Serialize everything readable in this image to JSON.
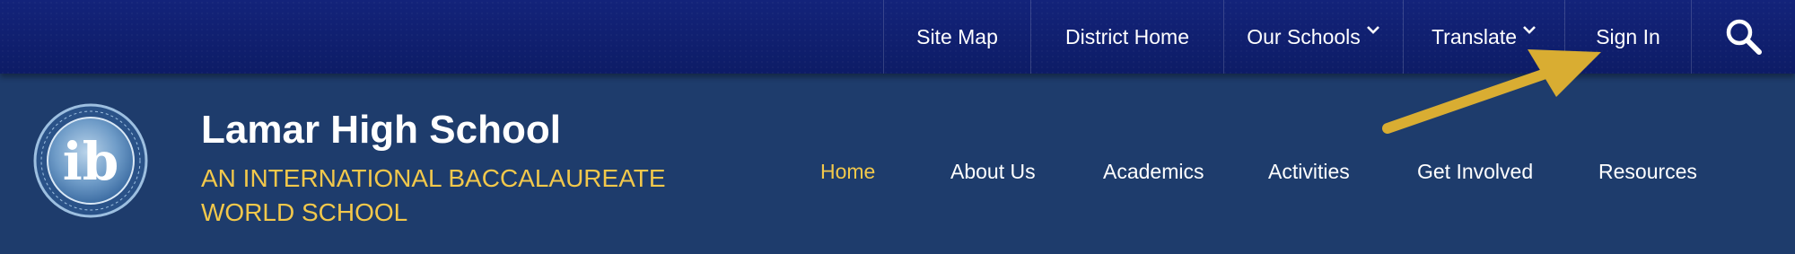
{
  "utility_nav": {
    "items": [
      {
        "label": "Site Map"
      },
      {
        "label": "District Home"
      },
      {
        "label": "Our Schools",
        "dropdown": true
      },
      {
        "label": "Translate",
        "dropdown": true
      },
      {
        "label": "Sign In"
      }
    ],
    "search_icon": "search-icon"
  },
  "school": {
    "name": "Lamar High School",
    "subtitle": "AN INTERNATIONAL BACCALAUREATE WORLD SCHOOL",
    "logo_text": "ib"
  },
  "main_nav": {
    "items": [
      {
        "label": "Home",
        "active": true
      },
      {
        "label": "About Us"
      },
      {
        "label": "Academics"
      },
      {
        "label": "Activities"
      },
      {
        "label": "Get Involved"
      },
      {
        "label": "Resources"
      }
    ]
  },
  "colors": {
    "utility_bg": "#0e1f6e",
    "header_bg": "#1e3c6c",
    "accent_gold": "#f2c84b",
    "arrow": "#d9ad32"
  }
}
